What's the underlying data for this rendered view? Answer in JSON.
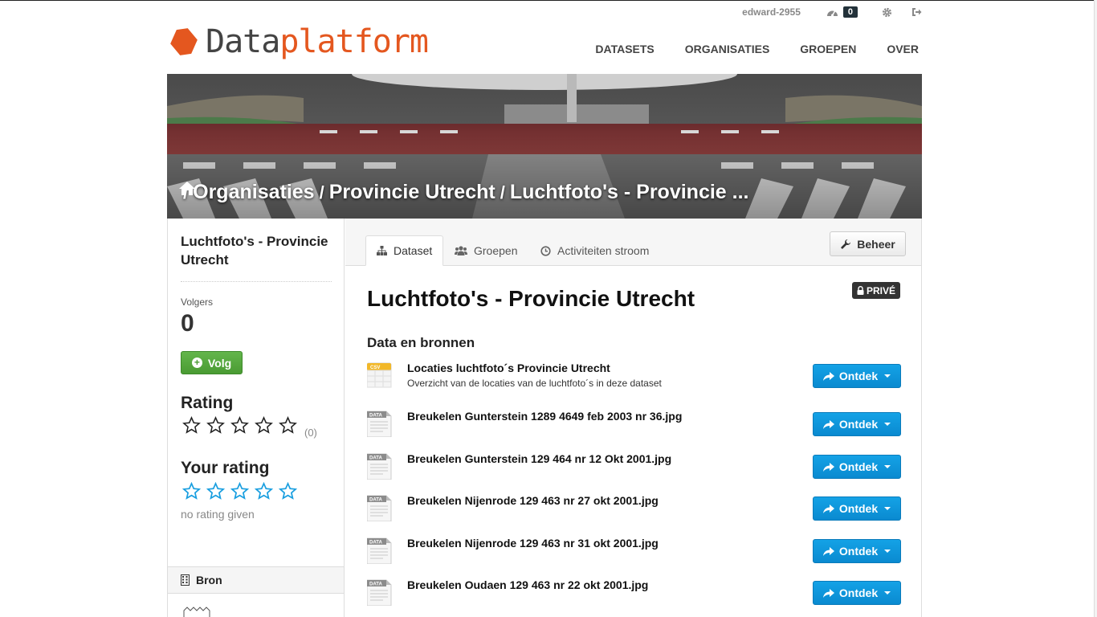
{
  "account": {
    "username": "edward-2955",
    "dashboard_count": "0"
  },
  "logo": {
    "part1": "Data",
    "part2": "platform"
  },
  "nav": {
    "datasets": "DATASETS",
    "organisaties": "ORGANISATIES",
    "groepen": "GROEPEN",
    "over": "OVER"
  },
  "breadcrumb": {
    "organisaties": "Organisaties",
    "organisation": "Provincie Utrecht",
    "dataset": "Luchtfoto's - Provincie ..."
  },
  "sidebar": {
    "title": "Luchtfoto's - Provincie Utrecht",
    "followers_label": "Volgers",
    "followers_count": "0",
    "follow_label": "Volg",
    "rating_heading": "Rating",
    "rating_count": "(0)",
    "your_rating_heading": "Your rating",
    "no_rating": "no rating given",
    "source_heading": "Bron"
  },
  "tabs": {
    "dataset": "Dataset",
    "groepen": "Groepen",
    "activiteiten": "Activiteiten stroom"
  },
  "manage_label": "Beheer",
  "dataset": {
    "title": "Luchtfoto's - Provincie Utrecht",
    "private_label": "PRIVÉ"
  },
  "resources_heading": "Data en bronnen",
  "explore_label": "Ontdek",
  "resources": [
    {
      "format": "CSV",
      "name": "Locaties luchtfoto´s Provincie Utrecht",
      "description": "Overzicht van de locaties van de luchtfoto´s in deze dataset"
    },
    {
      "format": "DATA",
      "name": "Breukelen Gunterstein 1289 4649 feb 2003 nr 36.jpg",
      "description": ""
    },
    {
      "format": "DATA",
      "name": "Breukelen Gunterstein 129 464 nr 12 Okt 2001.jpg",
      "description": ""
    },
    {
      "format": "DATA",
      "name": "Breukelen Nijenrode 129 463 nr 27 okt 2001.jpg",
      "description": ""
    },
    {
      "format": "DATA",
      "name": "Breukelen Nijenrode 129 463 nr 31 okt 2001.jpg",
      "description": ""
    },
    {
      "format": "DATA",
      "name": "Breukelen Oudaen 129 463 nr 22 okt 2001.jpg",
      "description": ""
    }
  ],
  "colors": {
    "brand_orange": "#e4571f",
    "follow_green": "#4a9b33",
    "explore_blue": "#0a8ad0",
    "star_blue": "#1a9fe0"
  },
  "rating": {
    "average_stars": 0,
    "max_stars": 5,
    "user_stars": 0
  }
}
